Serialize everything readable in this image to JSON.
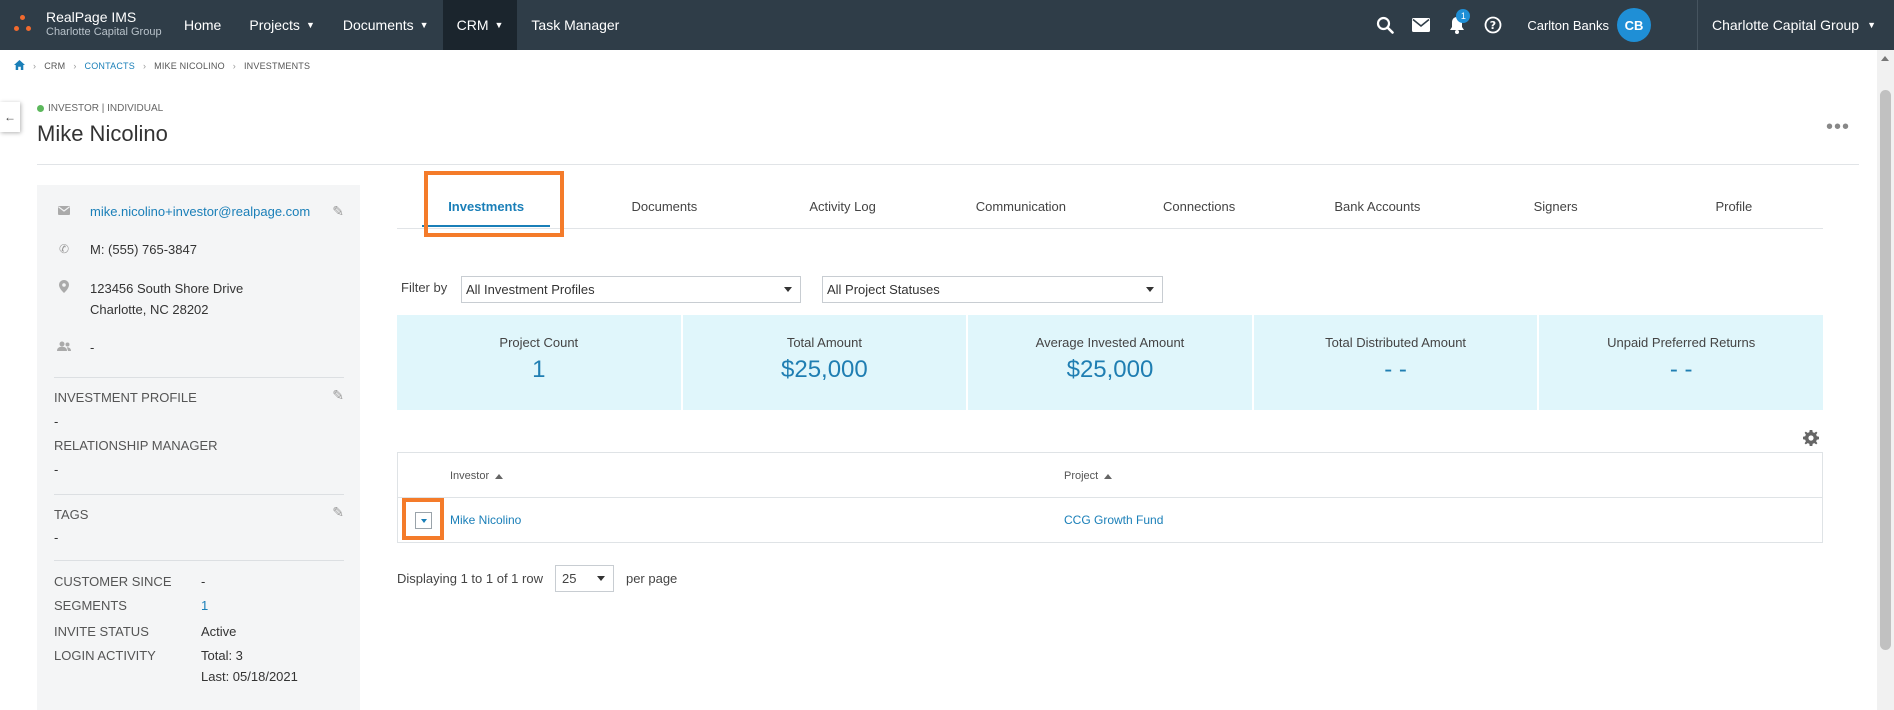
{
  "brand": {
    "title": "RealPage IMS",
    "subtitle": "Charlotte Capital Group"
  },
  "nav": {
    "items": [
      {
        "label": "Home"
      },
      {
        "label": "Projects"
      },
      {
        "label": "Documents"
      },
      {
        "label": "CRM"
      },
      {
        "label": "Task Manager"
      }
    ],
    "notifications_count": "1",
    "user_name": "Carlton Banks",
    "user_initials": "CB",
    "org": "Charlotte Capital Group"
  },
  "breadcrumb": [
    "CRM",
    "CONTACTS",
    "MIKE NICOLINO",
    "INVESTMENTS"
  ],
  "contact": {
    "type": "INVESTOR | INDIVIDUAL",
    "name": "Mike Nicolino",
    "email": "mike.nicolino+investor@realpage.com",
    "phone": "M: (555) 765-3847",
    "address_line1": "123456 South Shore Drive",
    "address_line2": "Charlotte, NC 28202",
    "contact_person": "-",
    "investment_profile_label": "INVESTMENT PROFILE",
    "investment_profile_value": "-",
    "relationship_manager_label": "RELATIONSHIP MANAGER",
    "relationship_manager_value": "-",
    "tags_label": "TAGS",
    "tags_value": "-",
    "customer_since_label": "CUSTOMER SINCE",
    "customer_since_value": "-",
    "segments_label": "SEGMENTS",
    "segments_value": "1",
    "invite_status_label": "INVITE STATUS",
    "invite_status_value": "Active",
    "login_activity_label": "LOGIN ACTIVITY",
    "login_total": "Total: 3",
    "login_last": "Last: 05/18/2021"
  },
  "tabs": [
    "Investments",
    "Documents",
    "Activity Log",
    "Communication",
    "Connections",
    "Bank Accounts",
    "Signers",
    "Profile"
  ],
  "filters": {
    "label": "Filter by",
    "profile": "All Investment Profiles",
    "status": "All Project Statuses"
  },
  "stats": [
    {
      "label": "Project Count",
      "value": "1"
    },
    {
      "label": "Total Amount",
      "value": "$25,000"
    },
    {
      "label": "Average Invested Amount",
      "value": "$25,000"
    },
    {
      "label": "Total Distributed Amount",
      "value": "- -"
    },
    {
      "label": "Unpaid Preferred Returns",
      "value": "- -"
    }
  ],
  "table": {
    "columns": [
      "Investor",
      "Project"
    ],
    "rows": [
      {
        "investor": "Mike Nicolino",
        "project": "CCG Growth Fund"
      }
    ]
  },
  "pager": {
    "display": "Displaying 1 to 1 of 1 row",
    "page_size": "25",
    "per_page": "per page"
  },
  "colors": {
    "nav_bg": "#2f3d48",
    "accent": "#1a7fb8",
    "highlight": "#f47b2a",
    "stat_bg": "#e0f6fb"
  }
}
